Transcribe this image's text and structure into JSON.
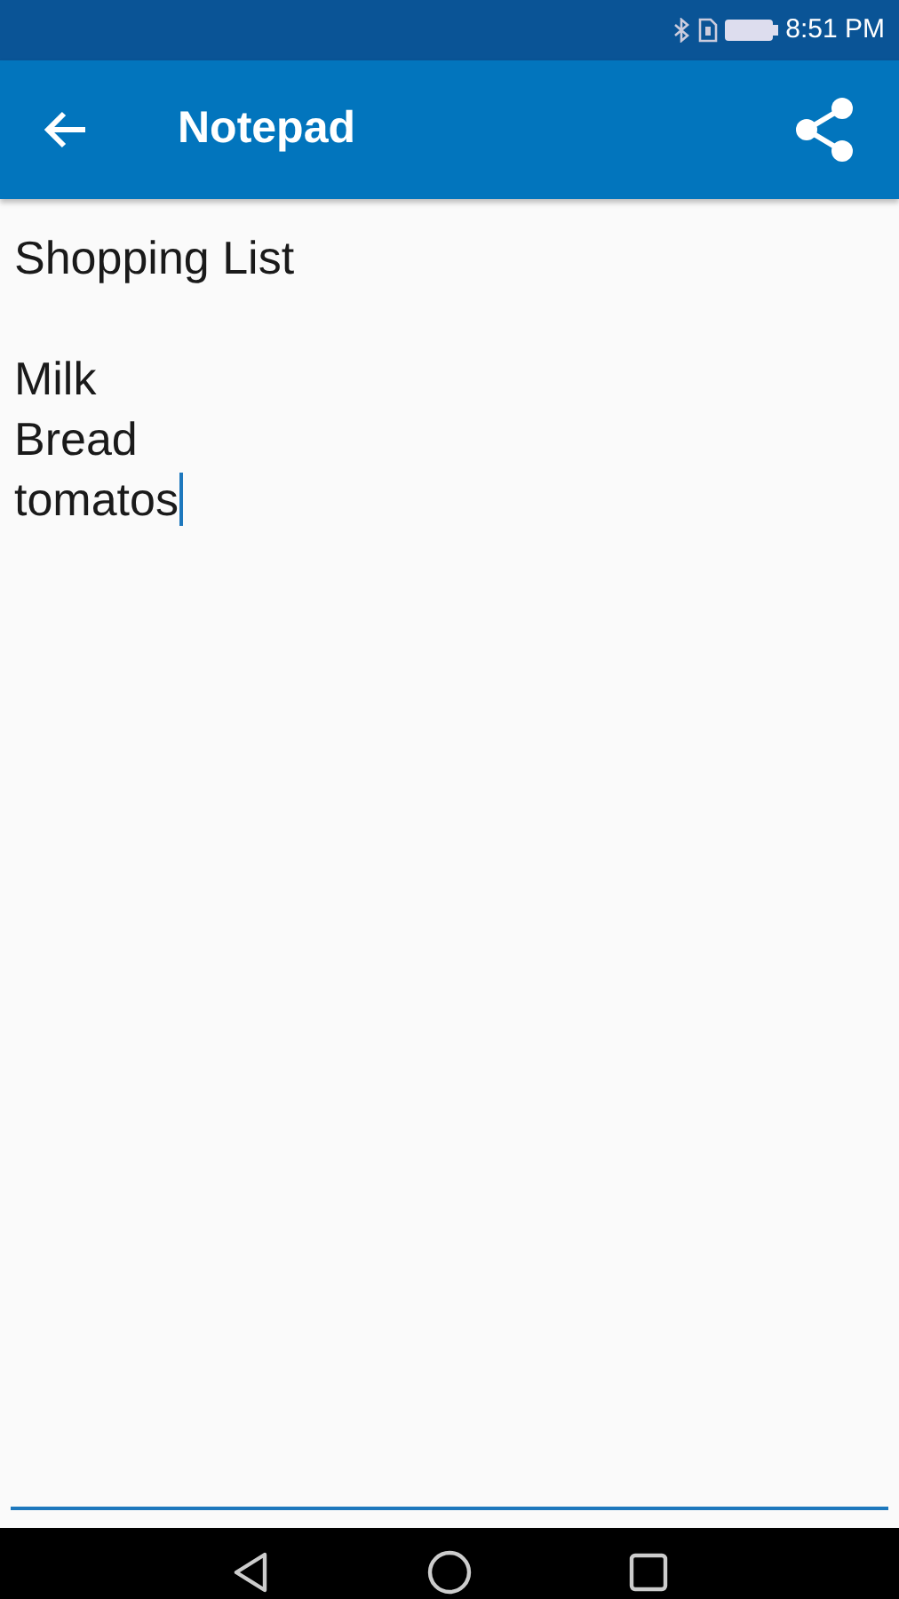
{
  "status_bar": {
    "time": "8:51 PM"
  },
  "app_bar": {
    "title": "Notepad"
  },
  "note": {
    "lines": [
      {
        "kind": "text",
        "text": "Shopping List"
      },
      {
        "kind": "blank"
      },
      {
        "kind": "text",
        "text": "Milk"
      },
      {
        "kind": "text",
        "text": "Bread"
      },
      {
        "kind": "text",
        "text": "tomatos"
      }
    ],
    "cursor_visible": true
  }
}
